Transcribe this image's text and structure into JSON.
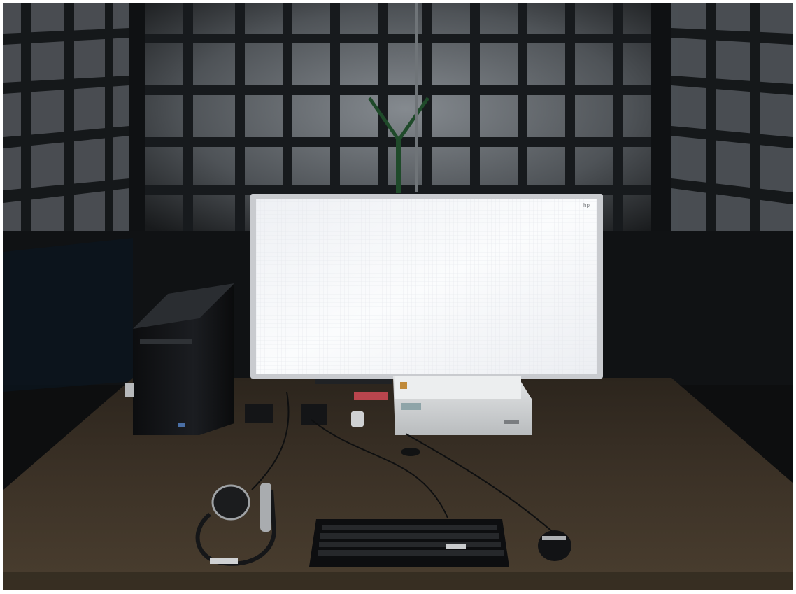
{
  "photo": {
    "subject": "desk-workstation",
    "colors": {
      "background": "#0e0f10",
      "wall_grid": "#7f8489",
      "desk": "#3e3428",
      "screen": "#f7f8fa",
      "printer": "#d9dbdc"
    }
  },
  "monitor": {
    "corner_label": "hp"
  }
}
